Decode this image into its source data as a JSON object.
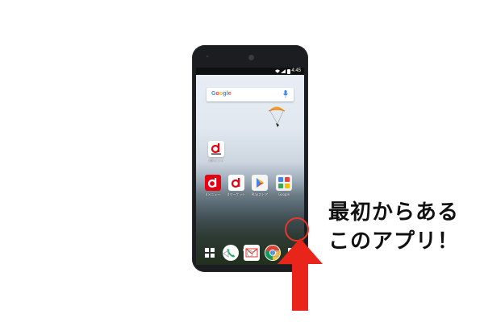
{
  "status_bar": {
    "time": "4:45"
  },
  "search_bar": {
    "logo_text": "Google"
  },
  "apps": {
    "dpoint": {
      "label": "dポイント",
      "letter": "d"
    },
    "row": [
      {
        "label": "dメニュー",
        "letter": "d"
      },
      {
        "label": "dマーケット",
        "letter": "d"
      },
      {
        "label": "Playストア",
        "icon": "play-store-icon"
      },
      {
        "label": "Google",
        "icon": "google-folder-icon"
      }
    ],
    "dock": [
      {
        "icon": "app-grid-icon"
      },
      {
        "icon": "phone-icon"
      },
      {
        "icon": "mail-icon"
      },
      {
        "icon": "chrome-icon"
      },
      {
        "icon": "app-drawer-icon"
      }
    ]
  },
  "annotation": {
    "line1": "最初からある",
    "line2": "このアプリ！",
    "highlight_color": "#e8372a"
  },
  "colors": {
    "docomo_red": "#e60012",
    "callout_text": "#111111",
    "phone_body": "#1c1d20"
  }
}
